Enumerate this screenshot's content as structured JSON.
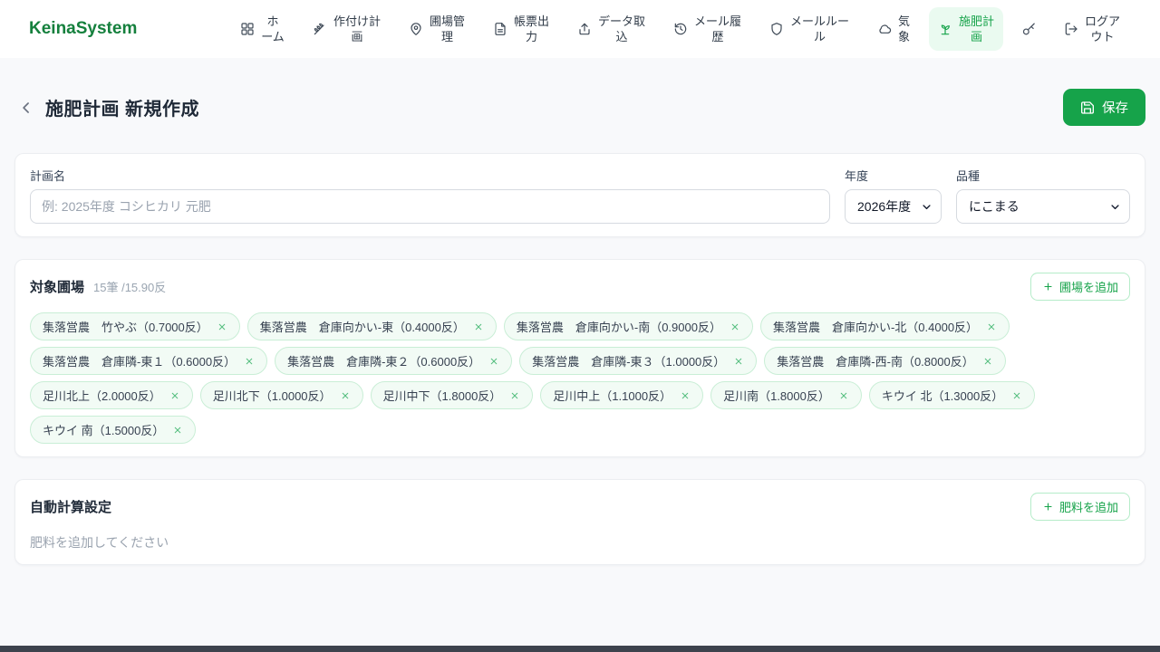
{
  "brand": {
    "name": "KeinaSystem"
  },
  "nav": {
    "items": [
      {
        "id": "home",
        "icon": "grid",
        "label": "ホーム",
        "active": false
      },
      {
        "id": "planting-plan",
        "icon": "wheat",
        "label": "作付け計画",
        "active": false
      },
      {
        "id": "field-management",
        "icon": "map-pin",
        "label": "圃場管理",
        "active": false
      },
      {
        "id": "report-output",
        "icon": "file",
        "label": "帳票出力",
        "active": false
      },
      {
        "id": "data-import",
        "icon": "upload",
        "label": "データ取込",
        "active": false
      },
      {
        "id": "mail-history",
        "icon": "history",
        "label": "メール履歴",
        "active": false
      },
      {
        "id": "mail-rules",
        "icon": "shield",
        "label": "メールルール",
        "active": false
      },
      {
        "id": "weather",
        "icon": "cloud",
        "label": "気象",
        "active": false
      },
      {
        "id": "fertilization-plan",
        "icon": "sprout",
        "label": "施肥計画",
        "active": true
      }
    ],
    "logout_label": "ログアウト"
  },
  "header": {
    "title": "施肥計画 新規作成",
    "save_label": "保存"
  },
  "form": {
    "plan_name_label": "計画名",
    "plan_name_placeholder": "例: 2025年度 コシヒカリ 元肥",
    "plan_name_value": "",
    "year_label": "年度",
    "year_value": "2026年度",
    "variety_label": "品種",
    "variety_value": "にこまる"
  },
  "fields_section": {
    "title": "対象圃場",
    "count_text": "15筆 /15.90反",
    "add_button_label": "圃場を追加",
    "chips": [
      "集落営農　竹やぶ（0.7000反）",
      "集落営農　倉庫向かい-東（0.4000反）",
      "集落営農　倉庫向かい-南（0.9000反）",
      "集落営農　倉庫向かい-北（0.4000反）",
      "集落営農　倉庫隣-東１（0.6000反）",
      "集落営農　倉庫隣-東２（0.6000反）",
      "集落営農　倉庫隣-東３（1.0000反）",
      "集落営農　倉庫隣-西-南（0.8000反）",
      "足川北上（2.0000反）",
      "足川北下（1.0000反）",
      "足川中下（1.8000反）",
      "足川中上（1.1000反）",
      "足川南（1.8000反）",
      "キウイ 北（1.3000反）",
      "キウイ 南（1.5000反）"
    ]
  },
  "fertilizer_section": {
    "title": "自動計算設定",
    "add_button_label": "肥料を追加",
    "empty_message": "肥料を追加してください"
  },
  "colors": {
    "brand_green": "#15803d",
    "accent_green": "#16a34a",
    "active_nav_bg": "#eafaf0",
    "chip_bg": "#f2fbf5",
    "chip_border": "#c9eed6",
    "page_bg": "#f8f9fb"
  }
}
